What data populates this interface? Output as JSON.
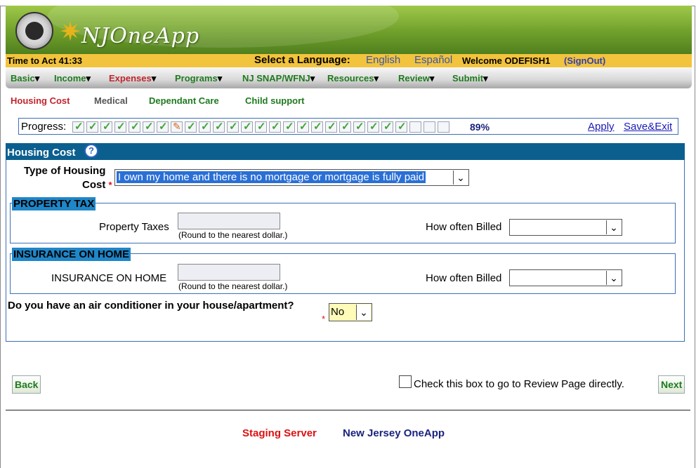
{
  "header": {
    "logo_text": "NJOneApp"
  },
  "topbar": {
    "time_to_act": "Time to Act 41:33",
    "select_language_label": "Select a Language:",
    "lang_english": "English",
    "lang_spanish": "Español",
    "welcome": "Welcome ODEFISH1",
    "signout": "(SignOut)"
  },
  "menu": {
    "items": [
      "Basic",
      "Income",
      "Expenses",
      "Programs",
      "NJ SNAP/WFNJ",
      "Resources",
      "Review",
      "Submit"
    ],
    "active": "Expenses"
  },
  "subnav": {
    "items": [
      "Housing Cost",
      "Medical",
      "Dependant Care",
      "Child support"
    ]
  },
  "progress": {
    "label": "Progress:",
    "percent": "89%",
    "percent_value": 0.89,
    "apply": "Apply",
    "save_exit": "Save&Exit",
    "steps_total": 27,
    "steps_completed": 24
  },
  "section": {
    "title": "Housing Cost",
    "housing_type_label_line1": "Type of Housing",
    "housing_type_label_line2": "Cost",
    "required_mark": "*",
    "housing_type_value": "I own my home and there is no mortgage or mortgage is fully paid",
    "property_tax": {
      "legend": "PROPERTY TAX",
      "field_label": "Property Taxes",
      "note": "(Round to the nearest dollar.)",
      "billed_label": "How often Billed",
      "billed_value": ""
    },
    "insurance": {
      "legend": "INSURANCE ON HOME",
      "field_label": "INSURANCE ON HOME",
      "note": "(Round to the nearest dollar.)",
      "billed_label": "How often Billed",
      "billed_value": ""
    },
    "air_conditioner_question": "Do you have an air conditioner in your house/apartment?",
    "air_conditioner_value": "No"
  },
  "actions": {
    "back": "Back",
    "next": "Next",
    "review_checkbox_label": "Check this box to go to Review Page directly."
  },
  "footer": {
    "server": "Staging Server",
    "app_name": "New Jersey OneApp"
  },
  "colors": {
    "header_green": "#6f9f2a",
    "topbar_yellow": "#f2c33c",
    "section_blue": "#0b5f8f",
    "legend_blue": "#1f86c8",
    "link_green": "#1e7a1e",
    "active_red": "#c0242c"
  }
}
